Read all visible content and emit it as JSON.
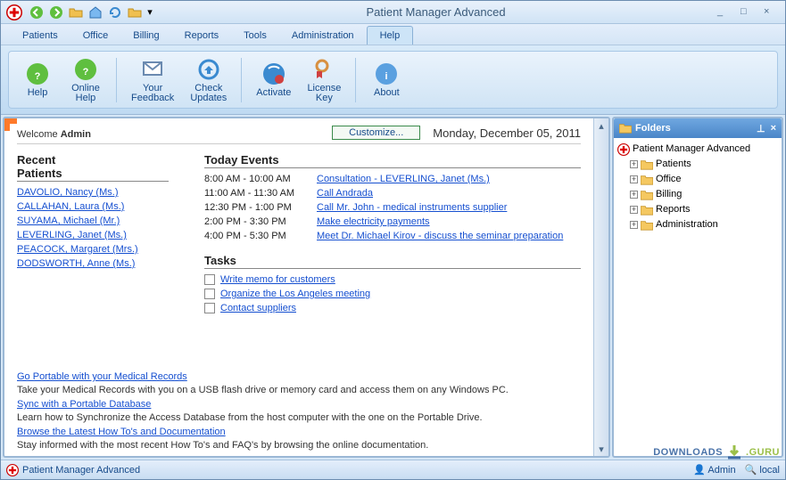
{
  "app": {
    "title": "Patient Manager Advanced"
  },
  "window_controls": {
    "min": "_",
    "max": "□",
    "close": "×"
  },
  "menubar": {
    "tabs": [
      "Patients",
      "Office",
      "Billing",
      "Reports",
      "Tools",
      "Administration",
      "Help"
    ],
    "active": "Help"
  },
  "ribbon": {
    "buttons": [
      {
        "label": "Help",
        "icon": "help"
      },
      {
        "label": "Online\nHelp",
        "icon": "online-help"
      },
      {
        "label": "Your\nFeedback",
        "icon": "feedback"
      },
      {
        "label": "Check\nUpdates",
        "icon": "updates"
      },
      {
        "label": "Activate",
        "icon": "activate"
      },
      {
        "label": "License\nKey",
        "icon": "license"
      },
      {
        "label": "About",
        "icon": "about"
      }
    ]
  },
  "dashboard": {
    "welcome_prefix": "Welcome ",
    "welcome_user": "Admin",
    "customize": "Customize...",
    "date": "Monday, December 05, 2011",
    "recent_patients_title": "Recent\nPatients",
    "recent_patients": [
      "DAVOLIO, Nancy (Ms.)",
      "CALLAHAN, Laura (Ms.)",
      "SUYAMA, Michael (Mr.)",
      "LEVERLING, Janet (Ms.)",
      "PEACOCK, Margaret (Mrs.)",
      "DODSWORTH, Anne (Ms.)"
    ],
    "events_title": "Today Events",
    "events": [
      {
        "time": "8:00 AM - 10:00 AM",
        "label": "Consultation - LEVERLING, Janet (Ms.)"
      },
      {
        "time": "11:00 AM - 11:30 AM",
        "label": "Call Andrada"
      },
      {
        "time": "12:30 PM - 1:00 PM",
        "label": "Call Mr. John - medical instruments supplier"
      },
      {
        "time": "2:00 PM - 3:30 PM",
        "label": "Make electricity payments"
      },
      {
        "time": "4:00 PM - 5:30 PM",
        "label": "Meet Dr. Michael Kirov - discuss the seminar preparation"
      }
    ],
    "tasks_title": "Tasks",
    "tasks": [
      "Write memo for customers",
      "Organize the Los Angeles meeting",
      "Contact suppliers"
    ],
    "tips": [
      {
        "link": "Go Portable with your Medical Records",
        "text": "Take your Medical Records with you on a USB flash drive or memory card and access them on any Windows PC."
      },
      {
        "link": "Sync with a Portable Database",
        "text": "Learn how to Synchronize the Access Database from the host computer with the one on the Portable Drive."
      },
      {
        "link": "Browse the Latest How To's and Documentation",
        "text": "Stay informed with the most recent How To's and FAQ's by browsing the online documentation."
      }
    ]
  },
  "folders": {
    "title": "Folders",
    "root": "Patient Manager Advanced",
    "items": [
      "Patients",
      "Office",
      "Billing",
      "Reports",
      "Administration"
    ]
  },
  "statusbar": {
    "app": "Patient Manager Advanced",
    "user": "Admin",
    "db": "local"
  },
  "watermark": {
    "a": "DOWNLOADS",
    "b": ".GURU"
  }
}
